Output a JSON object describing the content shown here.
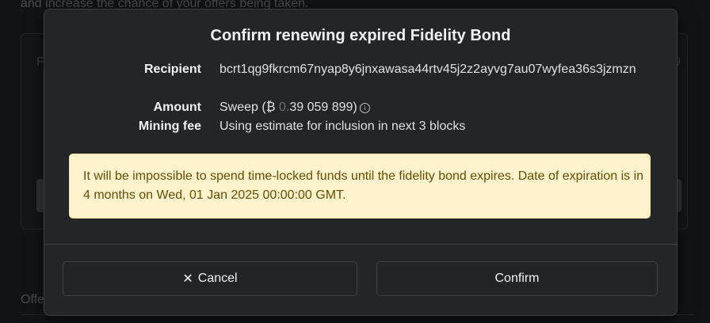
{
  "background": {
    "top_text": "and increase the chance of your offers being taken.",
    "left_glyph": "F",
    "right_glyph": "9",
    "bottom_text": "Offe"
  },
  "modal": {
    "title": "Confirm renewing expired Fidelity Bond",
    "details": {
      "recipient_label": "Recipient",
      "recipient_value": "bcrt1qg9fkrcm67nyap8y6jnxawasa44rtv45j2z2ayvg7au07wyfea36s3jzmzn",
      "amount_label": "Amount",
      "amount_prefix": "Sweep (",
      "btc_symbol": "₿",
      "amount_faded": "0.",
      "amount_value": "39 059 899",
      "amount_suffix": ")",
      "info_icon": "info-icon",
      "fee_label": "Mining fee",
      "fee_value": "Using estimate for inclusion in next 3 blocks"
    },
    "warning": "It will be impossible to spend time-locked funds until the fidelity bond expires. Date of expiration is in 4 months on Wed, 01 Jan 2025 00:00:00 GMT.",
    "buttons": {
      "cancel_icon": "✕",
      "cancel_label": "Cancel",
      "confirm_label": "Confirm"
    }
  },
  "colors": {
    "warning_bg": "#fff3cd",
    "warning_text": "#664d03",
    "modal_bg": "#232528"
  }
}
